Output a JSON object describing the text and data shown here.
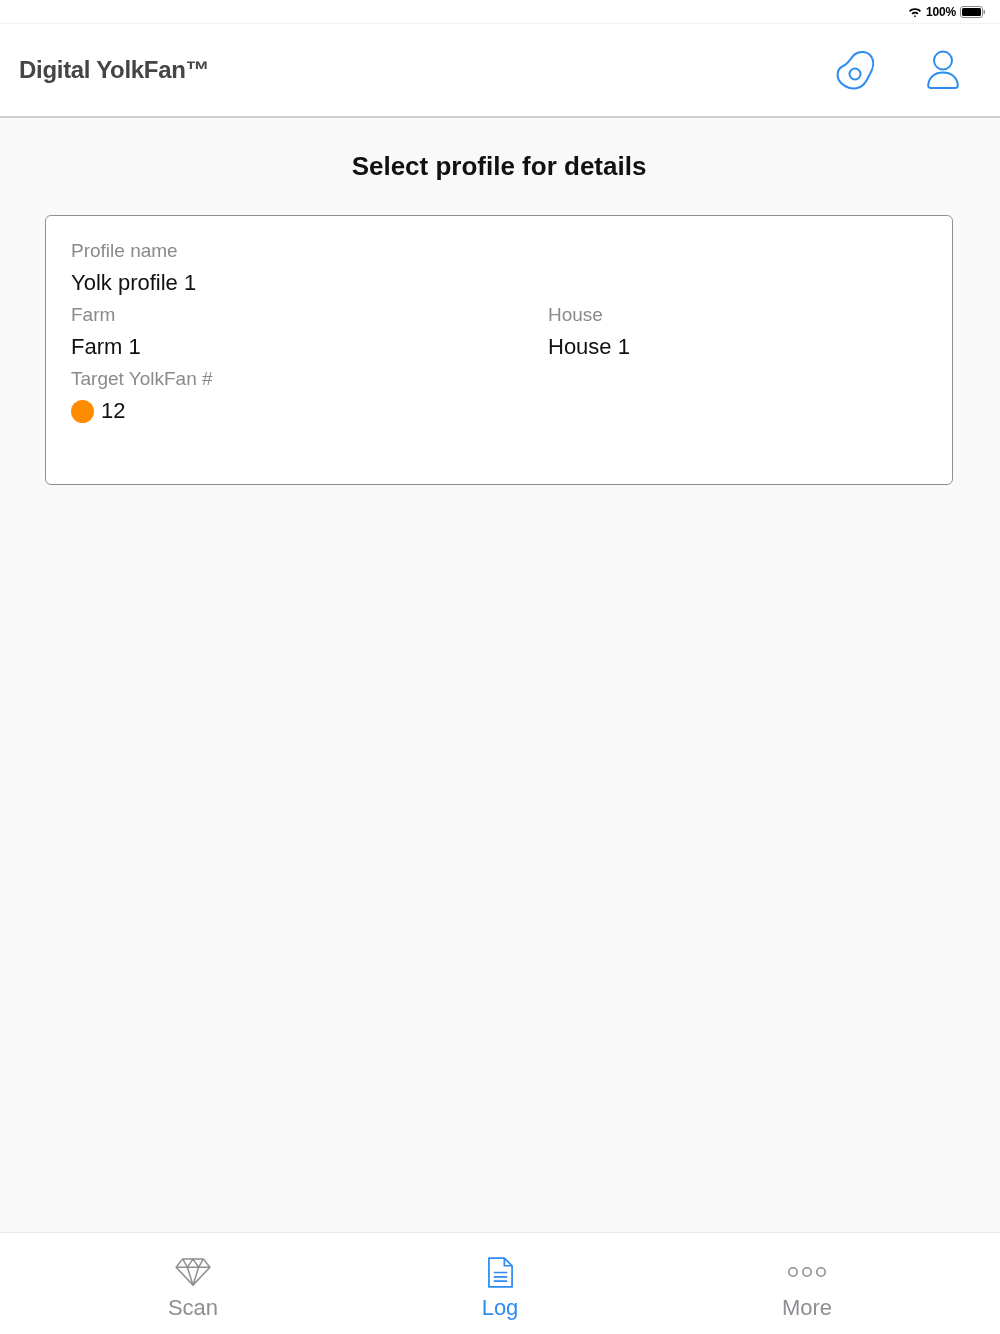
{
  "status_bar": {
    "battery_text": "100%"
  },
  "header": {
    "title": "Digital YolkFan™"
  },
  "page_title": "Select profile for details",
  "profile_card": {
    "rows": [
      {
        "fields": [
          {
            "label": "Profile name",
            "value": "Yolk profile 1"
          }
        ]
      },
      {
        "fields": [
          {
            "label": "Farm",
            "value": "Farm 1"
          },
          {
            "label": "House",
            "value": "House 1"
          }
        ]
      },
      {
        "fields": [
          {
            "label": "Target YolkFan #",
            "value": "12",
            "color": "#ff8c00"
          }
        ]
      }
    ]
  },
  "tab_bar": {
    "tabs": [
      {
        "label": "Scan",
        "kind": "scan",
        "selected": false
      },
      {
        "label": "Log",
        "kind": "log",
        "selected": true
      },
      {
        "label": "More",
        "kind": "more",
        "selected": false
      }
    ]
  }
}
